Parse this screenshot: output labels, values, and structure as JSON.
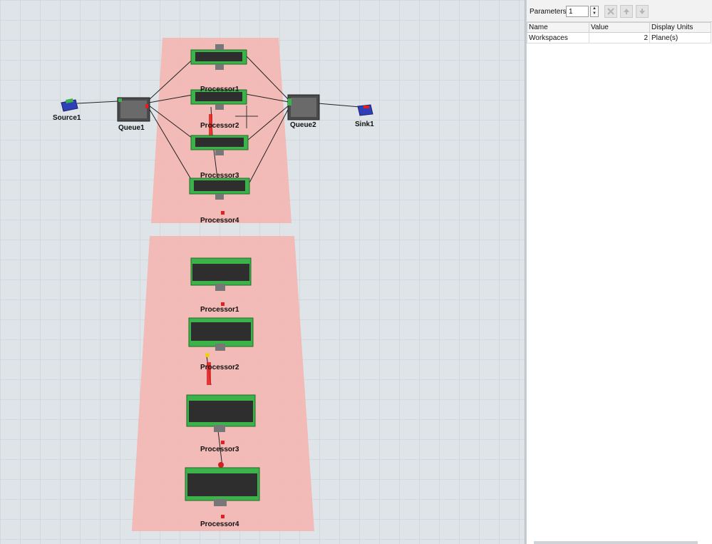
{
  "view3d": {
    "background_color": "#dfe4e8",
    "grid_color": "#c2cad0",
    "plane_color": "#f2b8b4",
    "labels": {
      "source": "Source1",
      "queue1": "Queue1",
      "queue2": "Queue2",
      "sink": "Sink1",
      "ws1_processors": [
        "Processor1",
        "Processor2",
        "Processor3",
        "Processor4"
      ],
      "ws2_processors": [
        "Processor1",
        "Processor2",
        "Processor3",
        "Processor4"
      ]
    }
  },
  "panel": {
    "parameters_label": "Parameters",
    "parameters_value": "1",
    "toolbar_icons": [
      "delete-icon",
      "arrow-up-icon",
      "arrow-down-icon"
    ],
    "columns": [
      "Name",
      "Value",
      "Display Units"
    ],
    "rows": [
      {
        "name": "Workspaces",
        "value": "2",
        "units": "Plane(s)"
      }
    ]
  }
}
